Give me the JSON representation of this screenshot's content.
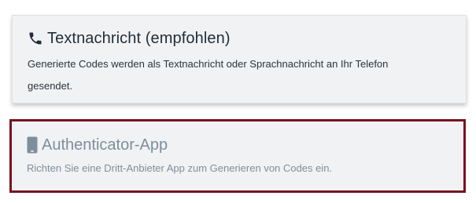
{
  "options": {
    "sms": {
      "icon": "phone-icon",
      "title": "Textnachricht (empfohlen)",
      "description": "Generierte Codes werden als Textnachricht oder Sprachnachricht an Ihr Telefon gesendet."
    },
    "app": {
      "icon": "mobile-device-icon",
      "title": "Authenticator-App",
      "description": "Richten Sie eine Dritt-Anbieter App zum Generieren von Codes ein."
    }
  },
  "colors": {
    "card_background": "#f1f2f3",
    "selected_border": "#7a1020",
    "title_dark": "#1f2d3b",
    "muted_text": "#7d8e9d"
  }
}
